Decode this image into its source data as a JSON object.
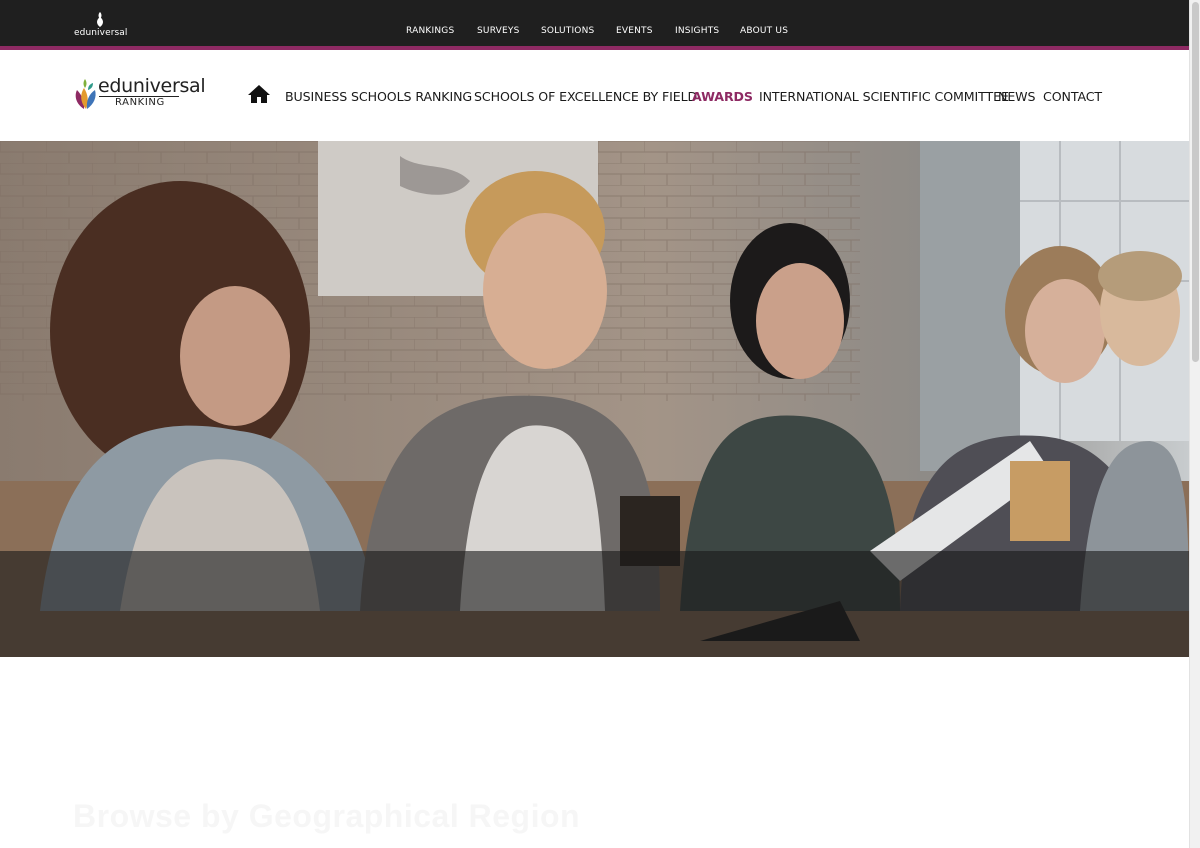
{
  "topbar": {
    "brand": "eduniversal",
    "nav": [
      "RANKINGS",
      "SURVEYS",
      "SOLUTIONS",
      "EVENTS",
      "INSIGHTS",
      "ABOUT US"
    ]
  },
  "mainnav": {
    "logo_word": "eduniversal",
    "logo_sub": "RANKING",
    "items": [
      "BUSINESS SCHOOLS RANKING",
      "SCHOOLS OF EXCELLENCE BY FIELD",
      "AWARDS",
      "INTERNATIONAL SCIENTIFIC COMMITTEE",
      "NEWS",
      "CONTACT"
    ],
    "active_item": "AWARDS"
  },
  "hero": {
    "image": "students-studying-photo"
  },
  "section": {
    "title": "Browse by Geographical Region"
  },
  "colors": {
    "topbar_bg": "#1f1f1f",
    "accent": "#8e2a63",
    "text": "#1a1a1a"
  },
  "icons": {
    "home": "home-icon",
    "logo": "leaf-logo-icon"
  }
}
